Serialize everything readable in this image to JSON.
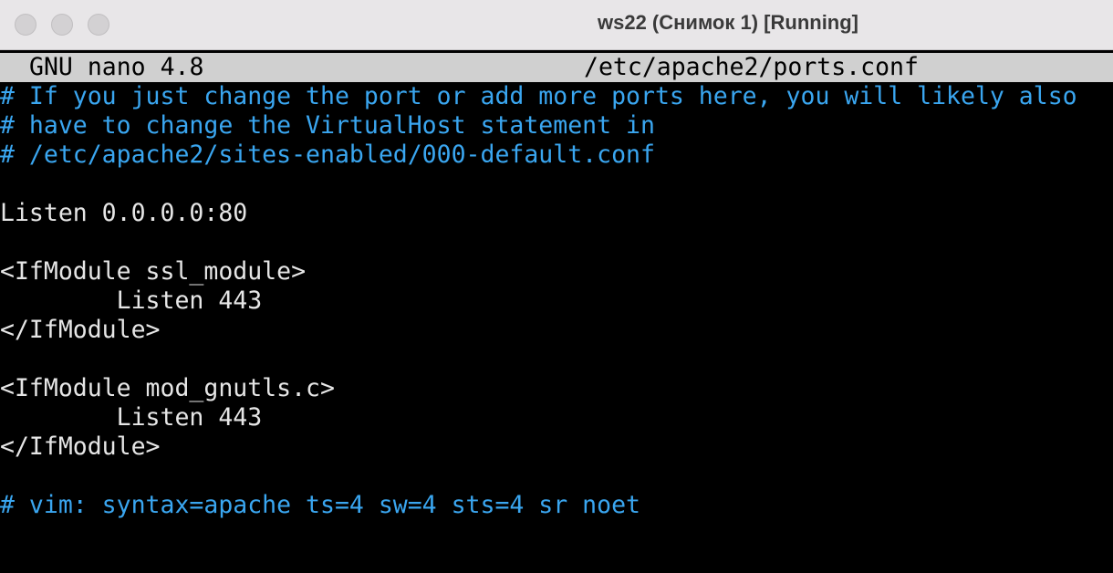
{
  "window": {
    "title": "ws22 (Снимок 1) [Running]"
  },
  "nano": {
    "program": "GNU nano 4.8",
    "filename": "/etc/apache2/ports.conf"
  },
  "colors": {
    "comment": "#3aa6f0",
    "text": "#e6e6e6",
    "background": "#000000",
    "header_bg": "#d0d0d0"
  },
  "file_lines": [
    "# If you just change the port or add more ports here, you will likely also",
    "# have to change the VirtualHost statement in",
    "# /etc/apache2/sites-enabled/000-default.conf",
    "",
    "Listen 0.0.0.0:80",
    "",
    "<IfModule ssl_module>",
    "        Listen 443",
    "</IfModule>",
    "",
    "<IfModule mod_gnutls.c>",
    "        Listen 443",
    "</IfModule>",
    "",
    "# vim: syntax=apache ts=4 sw=4 sts=4 sr noet"
  ]
}
